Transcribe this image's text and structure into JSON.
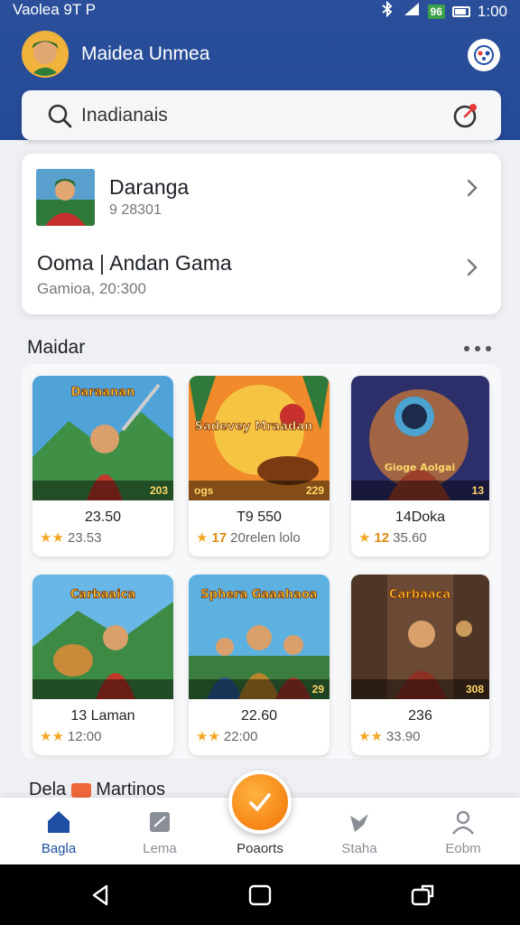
{
  "status_bar": {
    "left_text": "Vaolea 9T P",
    "badge": "96",
    "time": "1:00"
  },
  "header": {
    "user_name": "Maidea Unmea",
    "search_placeholder": "Inadianais"
  },
  "featured": {
    "items": [
      {
        "title": "Daranga",
        "subtitle": "9 28301"
      },
      {
        "title": "Ooma | Andan Gama",
        "subtitle": "Gamioa, 20:300"
      }
    ]
  },
  "section": {
    "title": "Maidar"
  },
  "games": [
    {
      "art_label": "Daraanan",
      "strip_right": "203",
      "title": "23.50",
      "rating": "",
      "meta": "23.53"
    },
    {
      "art_label": "Sadevey Mraadan",
      "strip_left": "ogs",
      "strip_right": "229",
      "title": "T9 550",
      "rating": "17",
      "meta": "20relen lolo"
    },
    {
      "art_label": "Gioge Aolgai",
      "strip_right": "13",
      "title": "14Doka",
      "rating": "12",
      "meta": "35.60"
    },
    {
      "art_label": "Carbaaica",
      "strip_right": "",
      "title": "13 Laman",
      "rating": "",
      "meta": "12:00"
    },
    {
      "art_label": "Sphera Gaaahaoa",
      "strip_right": "29",
      "title": "22.60",
      "rating": "",
      "meta": "22:00"
    },
    {
      "art_label": "Carbaaca",
      "strip_right": "308",
      "title": "236",
      "rating": "",
      "meta": "33.90"
    }
  ],
  "peek_section": {
    "title_left": "Dela",
    "title_right": "Martinos"
  },
  "bottom_nav": [
    {
      "label": "Bagla",
      "icon": "home-icon",
      "active": true
    },
    {
      "label": "Lema",
      "icon": "tablet-icon",
      "active": false
    },
    {
      "label": "Poaorts",
      "icon": "check-circle-icon",
      "active": false
    },
    {
      "label": "Staha",
      "icon": "wand-icon",
      "active": false
    },
    {
      "label": "Eobm",
      "icon": "user-icon",
      "active": false
    }
  ],
  "colors": {
    "header_blue": "#2b4f9a",
    "accent_orange": "#f57f0f",
    "active_nav": "#1f4fa3"
  }
}
